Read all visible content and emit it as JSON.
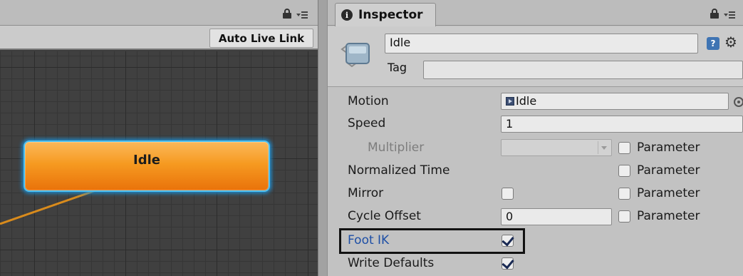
{
  "animator": {
    "live_link_label": "Auto Live Link",
    "state_node": {
      "label": "Idle",
      "color": "#f69a21",
      "selected_outline": "#4ec1f2"
    }
  },
  "inspector": {
    "tab_label": "Inspector",
    "tab_icon": "info-icon",
    "name_value": "Idle",
    "tag_label": "Tag",
    "tag_value": "",
    "help_icon_glyph": "?",
    "properties": {
      "motion": {
        "label": "Motion",
        "value": "Idle",
        "value_icon": "animation-clip-icon"
      },
      "speed": {
        "label": "Speed",
        "value": "1"
      },
      "multiplier": {
        "label": "Multiplier",
        "value": ""
      },
      "normalized_time": {
        "label": "Normalized Time"
      },
      "mirror": {
        "label": "Mirror",
        "checked": false
      },
      "cycle_offset": {
        "label": "Cycle Offset",
        "value": "0"
      },
      "foot_ik": {
        "label": "Foot IK",
        "checked": true
      },
      "write_defaults": {
        "label": "Write Defaults",
        "checked": true
      }
    },
    "parameter_label": "Parameter",
    "parameter_rows": [
      {
        "row": "multiplier",
        "checked": false
      },
      {
        "row": "normalized_time",
        "checked": false
      },
      {
        "row": "mirror",
        "checked": false
      },
      {
        "row": "cycle_offset",
        "checked": false
      }
    ]
  }
}
